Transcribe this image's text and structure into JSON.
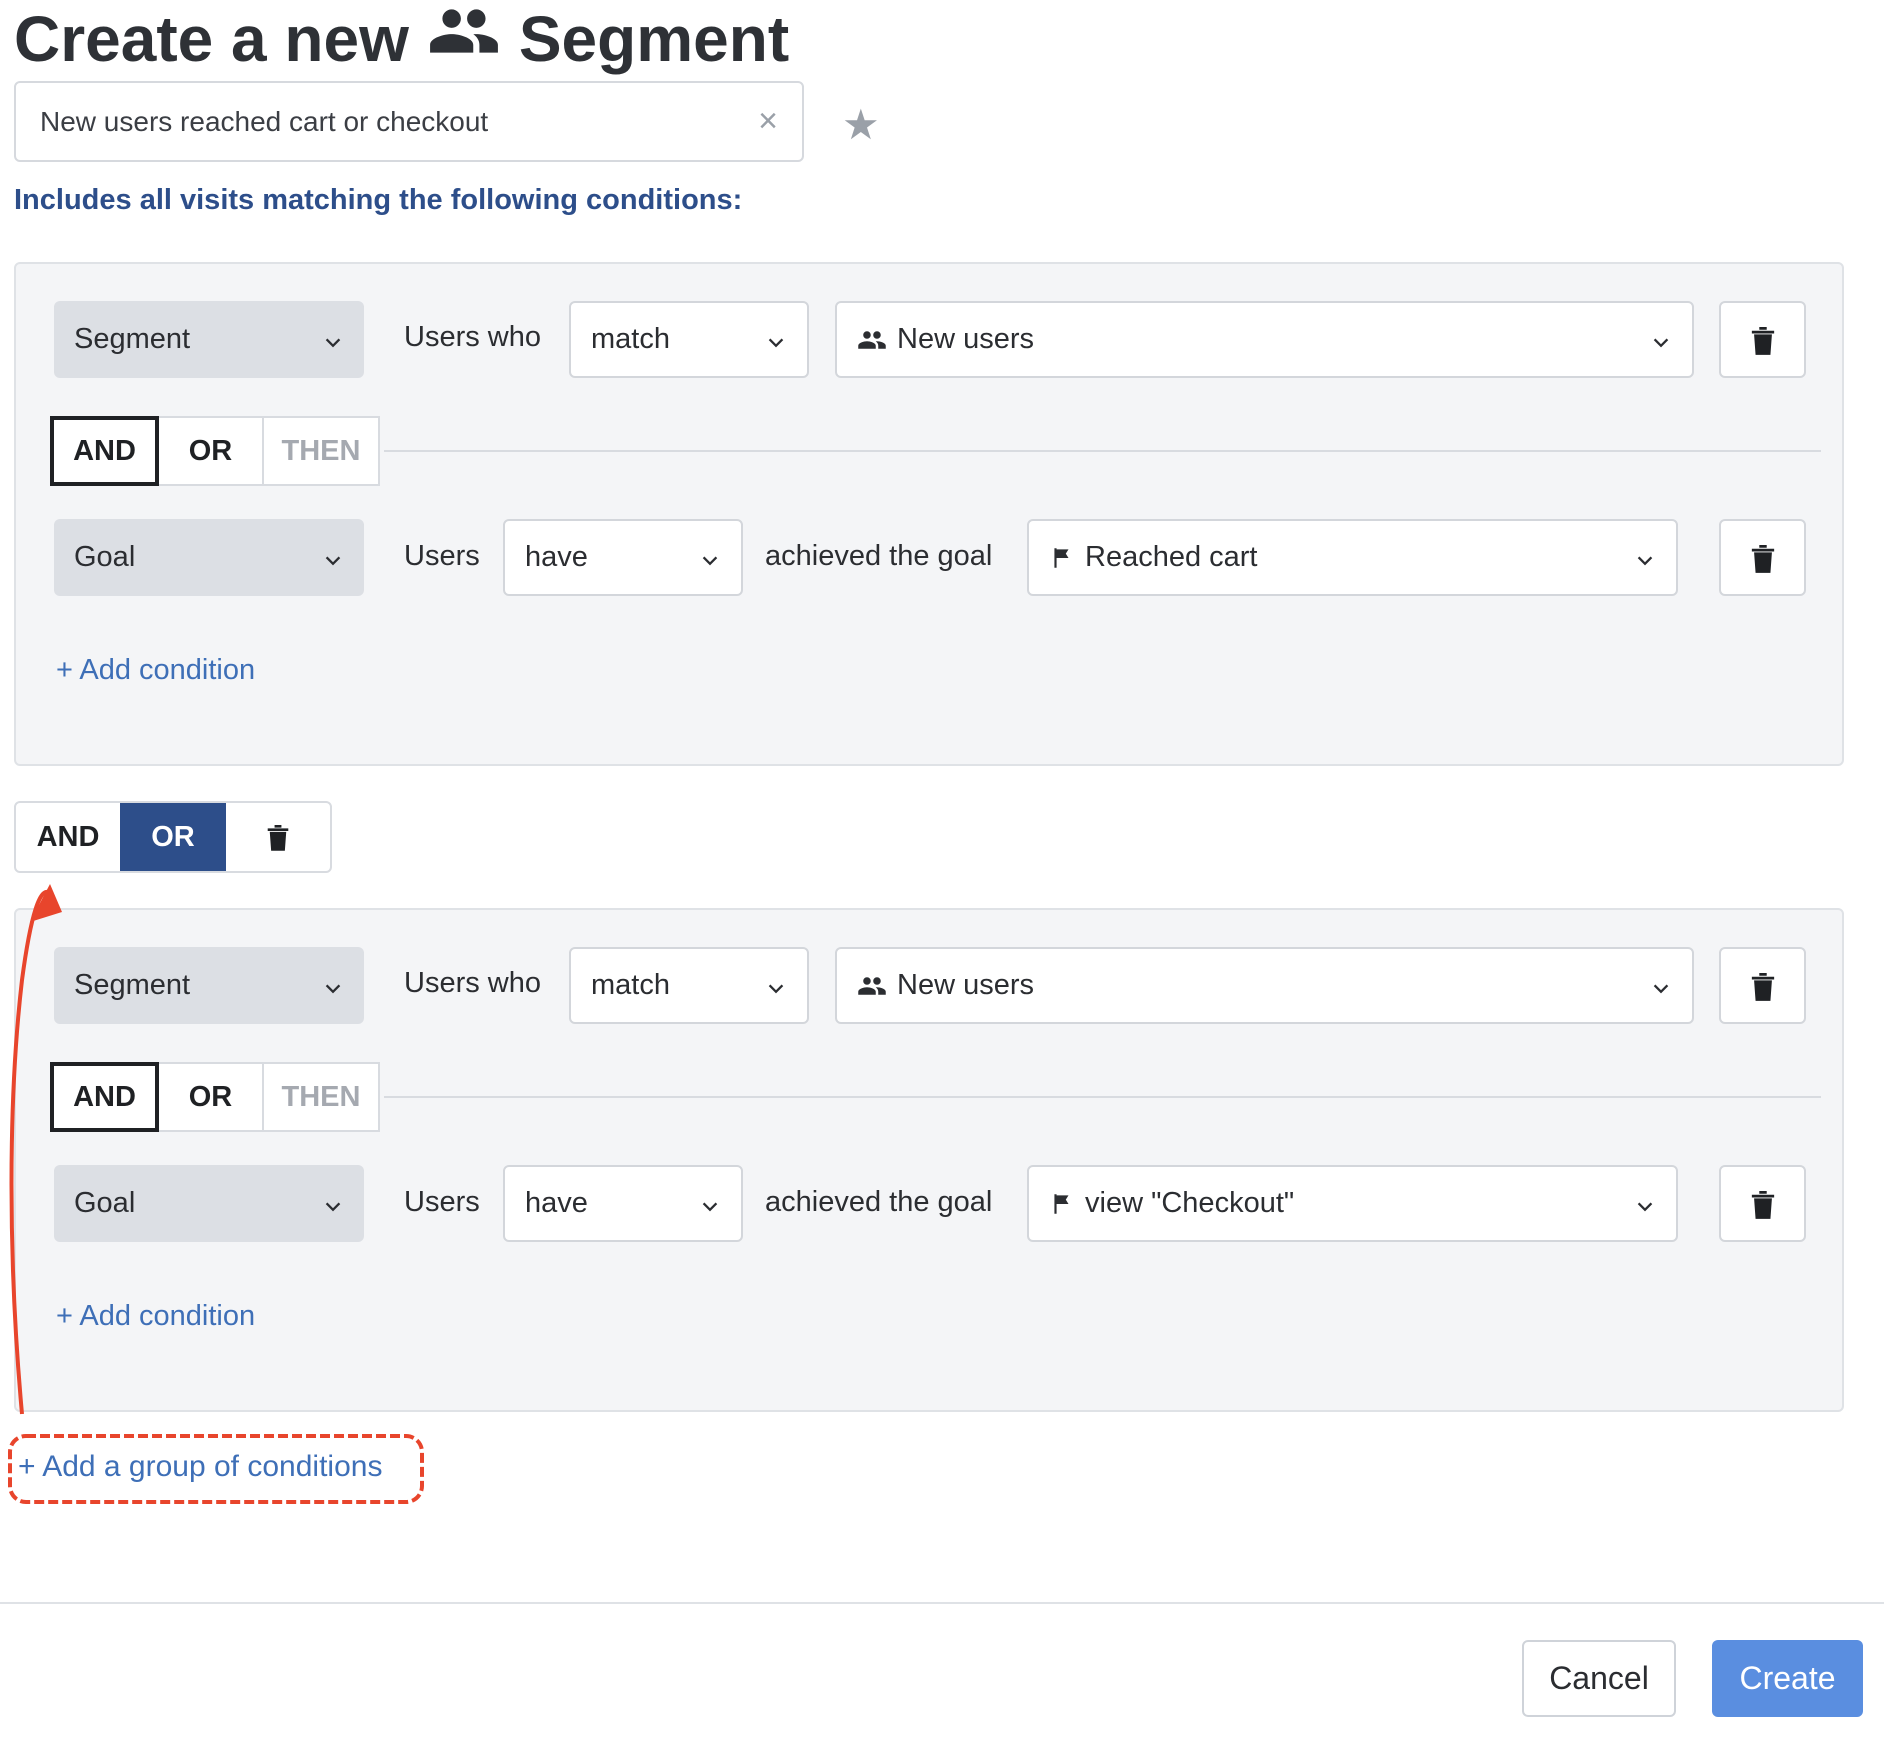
{
  "title": {
    "prefix": "Create a new",
    "icon": "users-icon",
    "suffix": "Segment"
  },
  "segment_name": {
    "value": "New users reached cart or checkout",
    "clear_icon": "×",
    "star_icon": "★"
  },
  "includes_text": "Includes all visits matching the following conditions:",
  "groups": [
    {
      "row1": {
        "type": "Segment",
        "label": "Users who",
        "operator": "match",
        "value": "New users",
        "value_icon": "users-icon"
      },
      "connector": {
        "and": "AND",
        "or": "OR",
        "then": "THEN",
        "selected": "AND"
      },
      "row2": {
        "type": "Goal",
        "label": "Users",
        "operator": "have",
        "label2": "achieved the goal",
        "value": "Reached cart",
        "value_icon": "flag-icon"
      },
      "add_condition": "+ Add condition"
    },
    {
      "row1": {
        "type": "Segment",
        "label": "Users who",
        "operator": "match",
        "value": "New users",
        "value_icon": "users-icon"
      },
      "connector": {
        "and": "AND",
        "or": "OR",
        "then": "THEN",
        "selected": "AND"
      },
      "row2": {
        "type": "Goal",
        "label": "Users",
        "operator": "have",
        "label2": "achieved the goal",
        "value": "view \"Checkout\"",
        "value_icon": "flag-icon"
      },
      "add_condition": "+ Add condition"
    }
  ],
  "group_connector": {
    "and": "AND",
    "or": "OR",
    "selected": "OR"
  },
  "add_group": "+ Add a group of conditions",
  "footer": {
    "cancel": "Cancel",
    "create": "Create"
  },
  "colors": {
    "accent": "#2d4e8a",
    "link": "#3e6fb7",
    "primary_button": "#5a8ee0",
    "annotation": "#e8452c"
  }
}
